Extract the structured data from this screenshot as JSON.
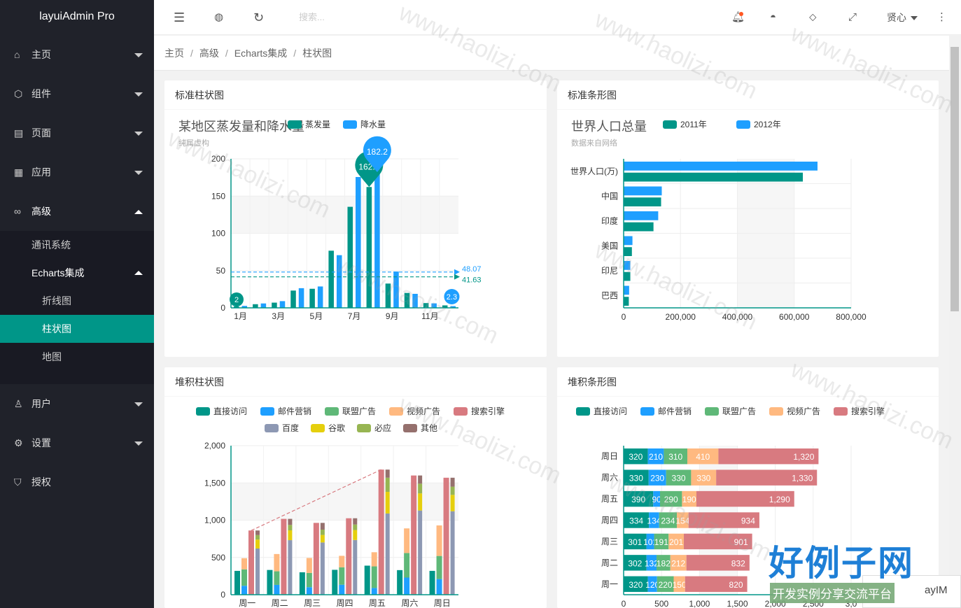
{
  "app": {
    "title": "layuiAdmin Pro"
  },
  "sidebar": {
    "items": [
      {
        "label": "主页",
        "icon": "home-icon"
      },
      {
        "label": "组件",
        "icon": "cube-icon"
      },
      {
        "label": "页面",
        "icon": "template-icon"
      },
      {
        "label": "应用",
        "icon": "app-icon"
      },
      {
        "label": "高级",
        "icon": "senior-icon"
      }
    ],
    "sub": [
      {
        "label": "通讯系统"
      },
      {
        "label": "Echarts集成"
      },
      {
        "label": "折线图"
      },
      {
        "label": "柱状图"
      },
      {
        "label": "地图"
      }
    ],
    "bottom": [
      {
        "label": "用户",
        "icon": "user-icon"
      },
      {
        "label": "设置",
        "icon": "gear-icon"
      },
      {
        "label": "授权",
        "icon": "auth-icon"
      }
    ]
  },
  "header": {
    "search_placeholder": "搜索...",
    "user": "贤心"
  },
  "breadcrumb": [
    "主页",
    "高级",
    "Echarts集成",
    "柱状图"
  ],
  "cards": {
    "c1": "标准柱状图",
    "c2": "标准条形图",
    "c3": "堆积柱状图",
    "c4": "堆积条形图"
  },
  "watermark": "www.haolizi.com",
  "brand": {
    "name": "好例子网",
    "slogan": "开发实例分享交流平台"
  },
  "layim": "ayIM",
  "colors": {
    "teal": "#009688",
    "blue": "#1e9fff",
    "green": "#5fb878",
    "orange": "#ffb980",
    "red": "#d87a80",
    "gray": "#8d98b3",
    "yellow": "#e5cf0d",
    "olive": "#97b552",
    "brown": "#95706d"
  },
  "chart_data": [
    {
      "type": "bar",
      "title": "某地区蒸发量和降水量",
      "subtitle": "纯属虚构",
      "categories": [
        "1月",
        "2月",
        "3月",
        "4月",
        "5月",
        "6月",
        "7月",
        "8月",
        "9月",
        "10月",
        "11月",
        "12月"
      ],
      "x_tick_labels": [
        "1月",
        "3月",
        "5月",
        "7月",
        "9月",
        "11月"
      ],
      "series": [
        {
          "name": "蒸发量",
          "values": [
            2.0,
            4.9,
            7.0,
            23.2,
            25.6,
            76.7,
            135.6,
            162.2,
            32.6,
            20.0,
            6.4,
            3.3
          ]
        },
        {
          "name": "降水量",
          "values": [
            2.6,
            5.9,
            9.0,
            26.4,
            28.7,
            70.7,
            175.6,
            182.2,
            48.7,
            18.8,
            6.0,
            2.3
          ]
        }
      ],
      "max_labels": [
        {
          "series": "蒸发量",
          "text": "162.2"
        },
        {
          "series": "降水量",
          "text": "182.2"
        }
      ],
      "min_labels": [
        {
          "series": "蒸发量",
          "text": "2"
        },
        {
          "series": "降水量",
          "text": "2.3"
        }
      ],
      "average_lines": [
        {
          "series": "降水量",
          "text": "48.07"
        },
        {
          "series": "蒸发量",
          "text": "41.63"
        }
      ],
      "ylim": [
        0,
        200
      ],
      "y_ticks": [
        0,
        50,
        100,
        150,
        200
      ],
      "legend": "top"
    },
    {
      "type": "bar",
      "orientation": "horizontal",
      "title": "世界人口总量",
      "subtitle": "数据来自网络",
      "categories": [
        "巴西",
        "印尼",
        "美国",
        "印度",
        "中国",
        "世界人口(万)"
      ],
      "series": [
        {
          "name": "2011年",
          "values": [
            18203,
            23489,
            29034,
            104970,
            131744,
            630230
          ]
        },
        {
          "name": "2012年",
          "values": [
            19325,
            23438,
            31000,
            121594,
            134141,
            681807
          ]
        }
      ],
      "xlim": [
        0,
        800000
      ],
      "x_ticks": [
        "0",
        "200,000",
        "400,000",
        "600,000",
        "800,000"
      ],
      "legend": "top"
    },
    {
      "type": "bar",
      "stacked": true,
      "categories": [
        "周一",
        "周二",
        "周三",
        "周四",
        "周五",
        "周六",
        "周日"
      ],
      "series": [
        {
          "name": "直接访问",
          "values": [
            320,
            332,
            301,
            334,
            390,
            330,
            320
          ]
        },
        {
          "name": "邮件营销",
          "values": [
            120,
            132,
            101,
            134,
            90,
            230,
            210
          ]
        },
        {
          "name": "联盟广告",
          "values": [
            220,
            182,
            191,
            234,
            290,
            330,
            310
          ]
        },
        {
          "name": "视频广告",
          "values": [
            150,
            232,
            201,
            154,
            190,
            330,
            410
          ]
        },
        {
          "name": "搜索引擎",
          "values": [
            862,
            1018,
            964,
            1026,
            1679,
            1600,
            1570
          ]
        },
        {
          "name": "百度",
          "values": [
            620,
            732,
            701,
            734,
            1090,
            1130,
            1120
          ]
        },
        {
          "name": "谷歌",
          "values": [
            120,
            132,
            101,
            134,
            290,
            230,
            220
          ]
        },
        {
          "name": "必应",
          "values": [
            60,
            72,
            71,
            74,
            190,
            130,
            110
          ]
        },
        {
          "name": "其他",
          "values": [
            62,
            82,
            91,
            84,
            109,
            110,
            120
          ]
        }
      ],
      "ylim": [
        0,
        2000
      ],
      "y_ticks": [
        "0",
        "500",
        "1,000",
        "1,500",
        "2,000"
      ],
      "legend": "top"
    },
    {
      "type": "bar",
      "orientation": "horizontal",
      "stacked": true,
      "categories": [
        "周一",
        "周二",
        "周三",
        "周四",
        "周五",
        "周六",
        "周日"
      ],
      "series": [
        {
          "name": "直接访问",
          "values": [
            320,
            302,
            301,
            334,
            390,
            330,
            320
          ]
        },
        {
          "name": "邮件营销",
          "values": [
            120,
            132,
            101,
            134,
            90,
            230,
            210
          ]
        },
        {
          "name": "联盟广告",
          "values": [
            220,
            182,
            191,
            234,
            290,
            330,
            310
          ]
        },
        {
          "name": "视频广告",
          "values": [
            150,
            212,
            201,
            154,
            190,
            330,
            410
          ]
        },
        {
          "name": "搜索引擎",
          "values": [
            820,
            832,
            901,
            934,
            1290,
            1330,
            1320
          ]
        }
      ],
      "xlim": [
        0,
        3000
      ],
      "x_ticks": [
        "0",
        "500",
        "1,000",
        "1,500",
        "2,000",
        "2,500",
        "3,0"
      ],
      "legend": "top"
    }
  ]
}
